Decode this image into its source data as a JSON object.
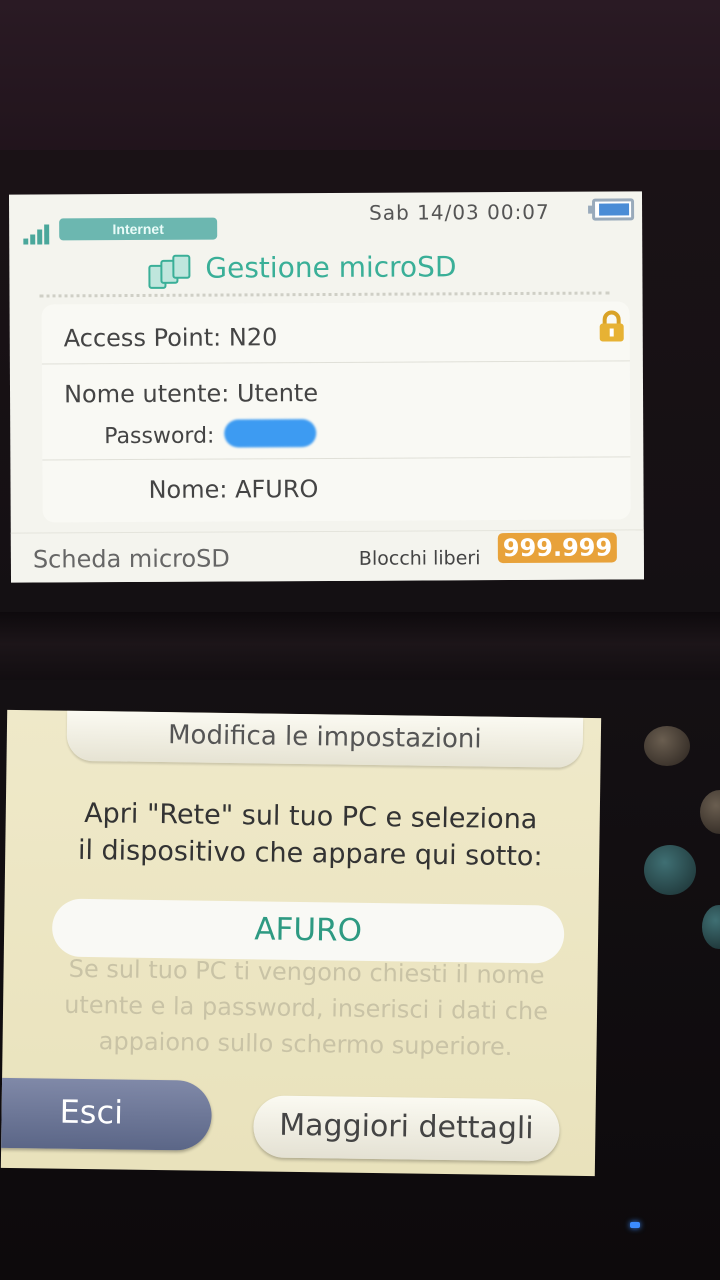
{
  "status_bar": {
    "network_badge": "Internet",
    "clock": "Sab 14/03 00:07",
    "signal_icon": "signal-bars-icon",
    "battery_icon": "battery-icon"
  },
  "top_screen": {
    "title": "Gestione microSD",
    "title_icon": "microsd-cards-icon",
    "access_point": "Access Point: N20",
    "lock_icon": "lock-icon",
    "username": "Nome utente: Utente",
    "password_label": "Password:",
    "device_name_line": "Nome: AFURO",
    "sd_label": "Scheda microSD",
    "blocks_label": "Blocchi liberi",
    "blocks_value": "999.999"
  },
  "bottom_screen": {
    "header_title": "Modifica le impostazioni",
    "instructions_line1": "Apri \"Rete\" sul tuo PC e seleziona",
    "instructions_line2": "il dispositivo che appare qui sotto:",
    "device_name": "AFURO",
    "note_line1": "Se sul tuo PC ti vengono chiesti il nome",
    "note_line2": "utente e la password, inserisci i dati che",
    "note_line3": "appaiono sullo schermo superiore.",
    "exit_label": "Esci",
    "details_label": "Maggiori dettagli"
  },
  "colors": {
    "accent_teal": "#3aaf98",
    "blocks_badge": "#e8a23a",
    "exit_button": "#5b6687",
    "password_redaction": "#3d9bf2"
  }
}
